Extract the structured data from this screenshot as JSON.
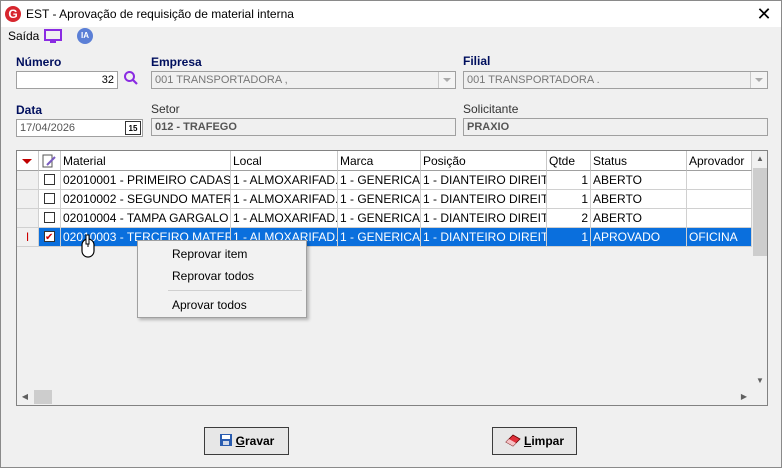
{
  "window": {
    "title": "EST - Aprovação de requisição de material interna",
    "logo_letter": "G",
    "close_glyph": "✕"
  },
  "menu": {
    "saida": "Saída",
    "ia": "IA"
  },
  "form": {
    "numero_label": "Número",
    "numero_value": "32",
    "empresa_label": "Empresa",
    "empresa_value": "001 TRANSPORTADORA ,",
    "filial_label": "Filial",
    "filial_value": "001 TRANSPORTADORA .",
    "data_label": "Data",
    "data_value": "17/04/2026",
    "calendar_glyph": "15",
    "setor_label": "Setor",
    "setor_value": "012 - TRAFEGO",
    "solicitante_label": "Solicitante",
    "solicitante_value": "PRAXIO"
  },
  "grid": {
    "columns": [
      "",
      "",
      "Material",
      "Local",
      "Marca",
      "Posição",
      "Qtde",
      "Status",
      "Aprovador"
    ],
    "rows": [
      {
        "checked": false,
        "selected": false,
        "indicator": "",
        "material": "02010001 - PRIMEIRO CADAST...",
        "local": "1 - ALMOXARIFAD...",
        "marca": "1 - GENERICA",
        "posicao": "1 - DIANTEIRO DIREITO",
        "qtde": "1",
        "status": "ABERTO",
        "aprovador": ""
      },
      {
        "checked": false,
        "selected": false,
        "indicator": "",
        "material": "02010002 - SEGUNDO MATERI...",
        "local": "1 - ALMOXARIFAD...",
        "marca": "1 - GENERICA",
        "posicao": "1 - DIANTEIRO DIREITO",
        "qtde": "1",
        "status": "ABERTO",
        "aprovador": ""
      },
      {
        "checked": false,
        "selected": false,
        "indicator": "",
        "material": "02010004 - TAMPA GARGALO ...",
        "local": "1 - ALMOXARIFAD...",
        "marca": "1 - GENERICA",
        "posicao": "1 - DIANTEIRO DIREITO",
        "qtde": "2",
        "status": "ABERTO",
        "aprovador": ""
      },
      {
        "checked": true,
        "selected": true,
        "indicator": "I",
        "material": "02010003 - TERCEIRO MATERI...",
        "local": "1 - ALMOXARIFAD...",
        "marca": "1 - GENERICA",
        "posicao": "1 - DIANTEIRO DIREITO",
        "qtde": "1",
        "status": "APROVADO",
        "aprovador": "OFICINA"
      }
    ]
  },
  "context_menu": {
    "items": [
      "Reprovar item",
      "Reprovar todos",
      "Aprovar todos"
    ]
  },
  "buttons": {
    "gravar": {
      "first": "G",
      "rest": "ravar"
    },
    "limpar": {
      "first": "L",
      "rest": "impar"
    }
  },
  "colors": {
    "selection": "#0a6fdd",
    "label_blue": "#000f5e",
    "accent_red": "#d7262e"
  }
}
